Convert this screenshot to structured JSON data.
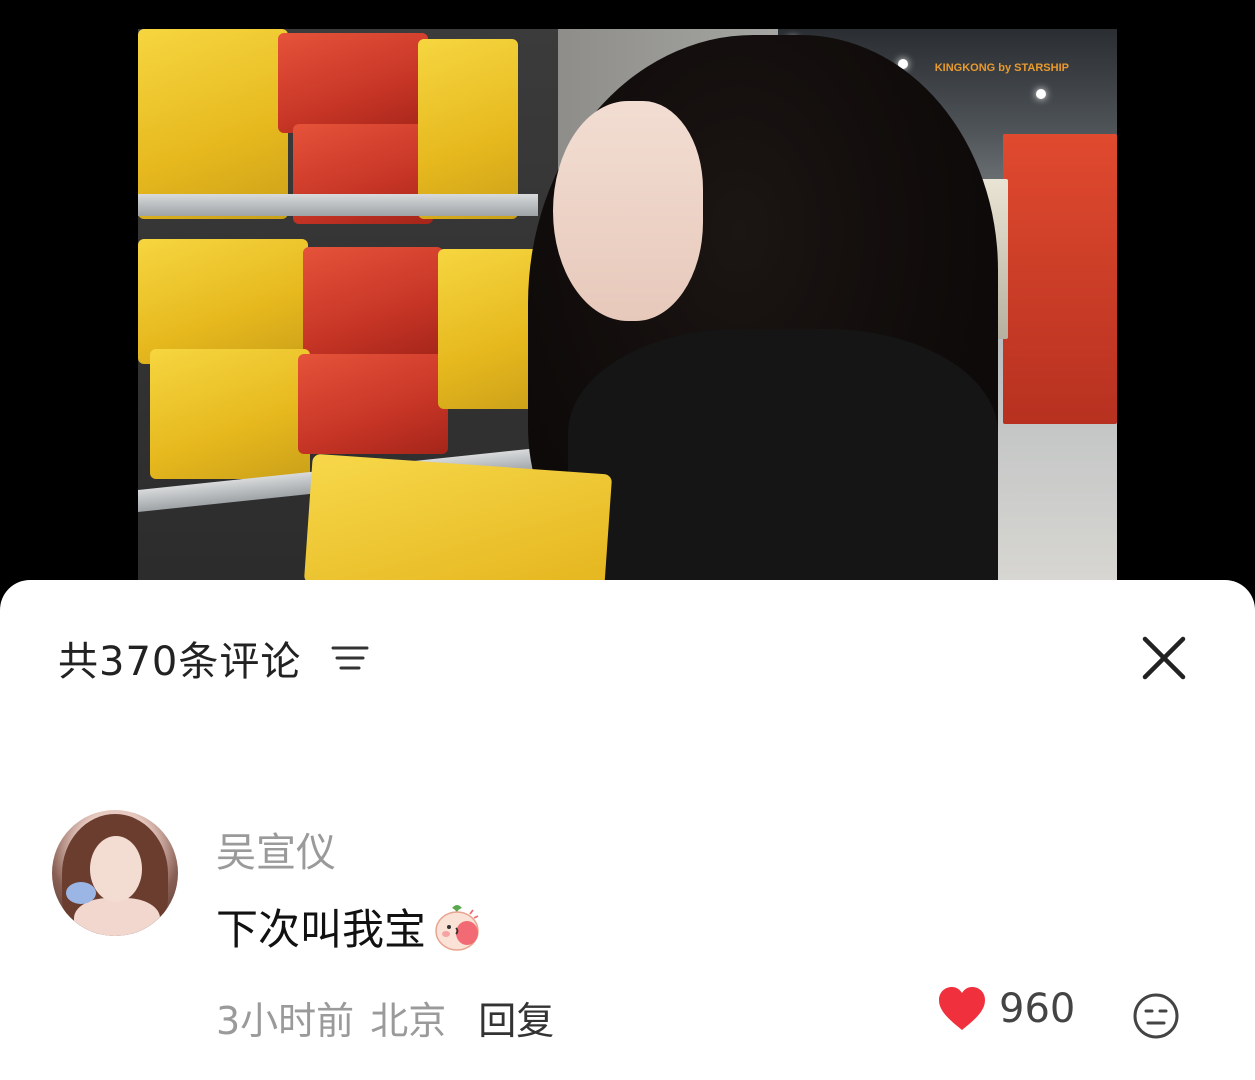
{
  "video": {
    "watermark": "KINGKONG by STARSHIP"
  },
  "comments_panel": {
    "title": "共370条评论",
    "filter_icon": "filter-lines-icon",
    "close_icon": "close-icon"
  },
  "comments": [
    {
      "username": "吴宣仪",
      "text": "下次叫我宝",
      "emoji": "peach-kiss-emoji",
      "time": "3小时前",
      "location": "北京",
      "reply_label": "回复",
      "likes": "960",
      "like_icon": "heart-icon",
      "like_color": "#f0303c",
      "emoji_reaction_icon": "neutral-face-icon"
    }
  ]
}
